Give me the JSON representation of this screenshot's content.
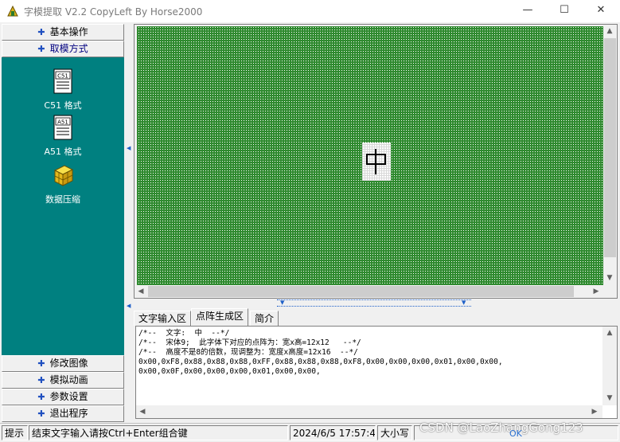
{
  "window": {
    "title": "字模提取 V2.2  CopyLeft By Horse2000",
    "minimize_glyph": "—",
    "maximize_glyph": "☐",
    "close_glyph": "✕"
  },
  "nav": {
    "top_items": [
      {
        "label": "基本操作",
        "icon": "star-icon"
      },
      {
        "label": "取模方式",
        "icon": "star-icon"
      }
    ],
    "bottom_items": [
      {
        "label": "修改图像",
        "icon": "star-icon"
      },
      {
        "label": "模拟动画",
        "icon": "star-icon"
      },
      {
        "label": "参数设置",
        "icon": "star-icon"
      },
      {
        "label": "退出程序",
        "icon": "star-icon"
      }
    ],
    "star_glyph": "✚"
  },
  "tools": [
    {
      "label": "C51 格式",
      "icon_text": "C51"
    },
    {
      "label": "A51 格式",
      "icon_text": "A51"
    },
    {
      "label": "数据压缩",
      "icon_text": ""
    }
  ],
  "editor": {
    "character": "中"
  },
  "tabs": [
    {
      "label": "文字输入区",
      "active": false
    },
    {
      "label": "点阵生成区",
      "active": true
    },
    {
      "label": "简介",
      "active": false
    }
  ],
  "output": {
    "lines": [
      "/*--  文字:  中  --*/",
      "/*--  宋体9;  此字体下对应的点阵为：宽x高=12x12   --*/",
      "/*--  高度不是8的倍数，现调整为：宽度x高度=12x16  --*/",
      "0x00,0xF8,0x88,0x88,0x88,0xFF,0x88,0x88,0x88,0xF8,0x00,0x00,0x00,0x01,0x00,0x00,",
      "0x00,0x0F,0x00,0x00,0x00,0x01,0x00,0x00,"
    ]
  },
  "status": {
    "hint_label": "提示",
    "hint_text": "结束文字输入请按Ctrl+Enter组合键",
    "datetime": "2024/6/5 17:57:40",
    "mode": "大小写",
    "ok": "OK"
  },
  "watermark": "CSDN @LaoZhangGong123",
  "colors": {
    "teal": "#008080",
    "grid_green": "#2f8a2f",
    "accent_blue": "#1e5fc8"
  }
}
